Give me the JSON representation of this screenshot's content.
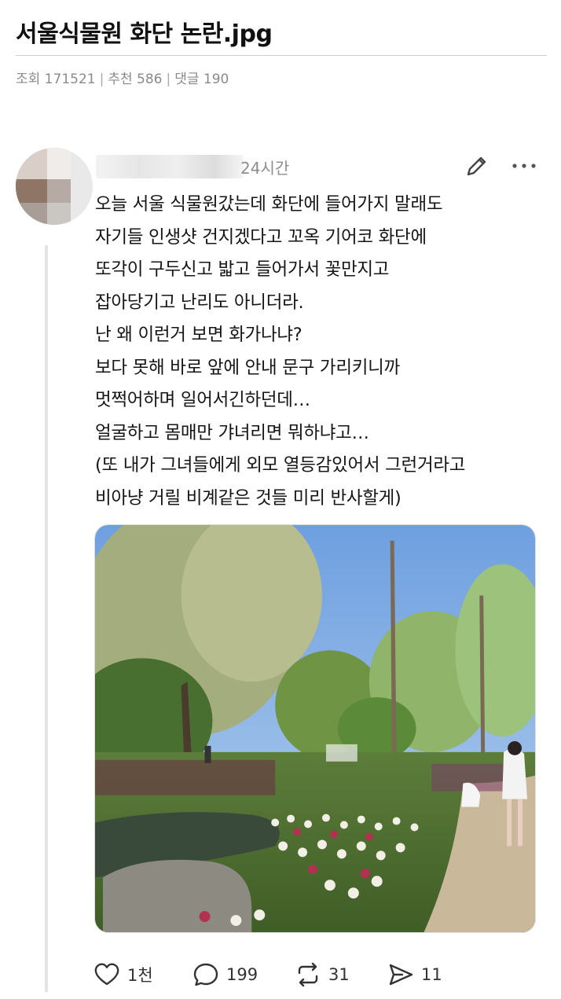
{
  "post": {
    "title": "서울식물원 화단 논란.jpg",
    "meta": {
      "views": "조회 171521",
      "recommends": "추천 586",
      "comments": "댓글 190"
    }
  },
  "tweet": {
    "timestamp": "24시간",
    "lines": [
      "오늘 서울 식물원갔는데 화단에 들어가지 말래도",
      "자기들 인생샷 건지겠다고 꼬옥 기어코 화단에",
      "또각이 구두신고 밟고 들어가서 꽃만지고",
      "잡아당기고 난리도 아니더라.",
      "난 왜 이런거 보면 화가나냐?",
      "보다 못해 바로 앞에 안내 문구 가리키니까",
      "멋쩍어하며 일어서긴하던데…",
      "얼굴하고 몸매만 갸녀리면 뭐하냐고…",
      "(또 내가 그녀들에게 외모 열등감있어서 그런거라고",
      "비아냥 거릴 비계같은 것들 미리 반사할게)"
    ],
    "actions": {
      "likes": "1천",
      "replies": "199",
      "reposts": "31",
      "shares": "11"
    },
    "icons": {
      "edit": "pencil-icon",
      "more": "more-dots-icon",
      "like": "heart-icon",
      "reply": "speech-bubble-icon",
      "repost": "repost-icon",
      "share": "send-icon"
    }
  },
  "colors": {
    "text": "#151515",
    "meta": "#8a8a8a",
    "thread_line": "#e4e4e4"
  }
}
